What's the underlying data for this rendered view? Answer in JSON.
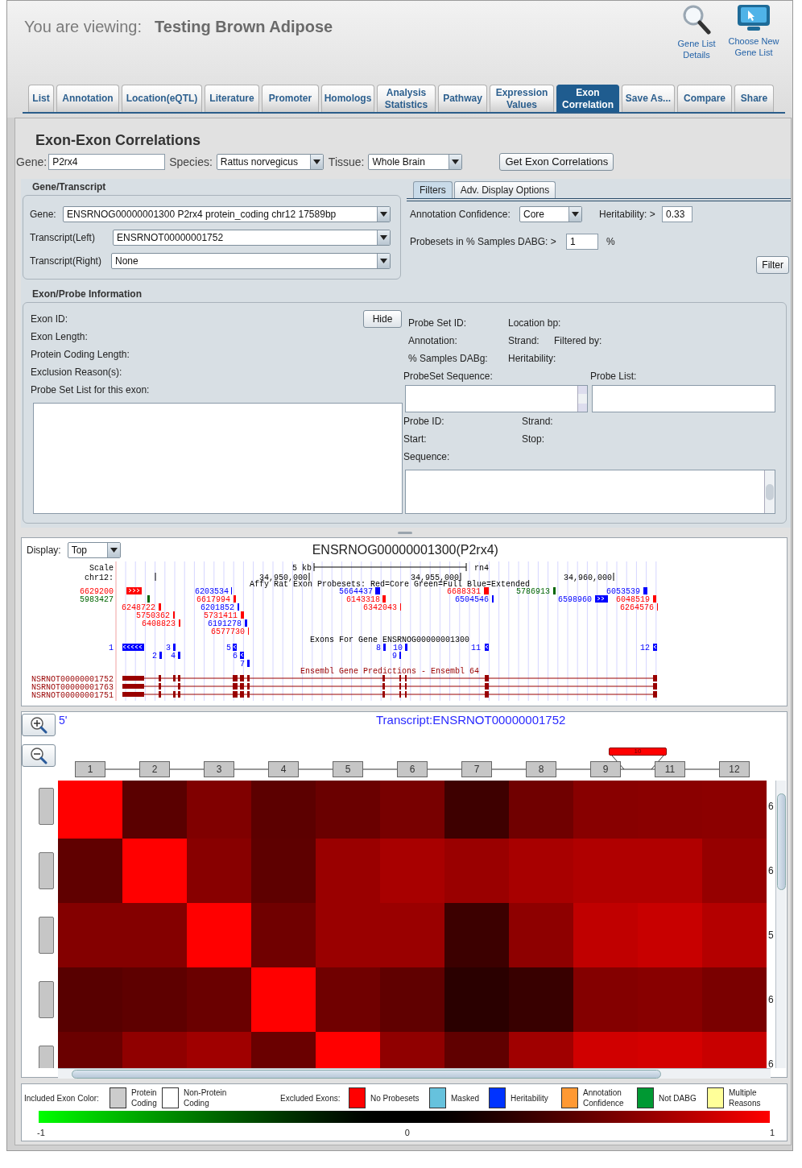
{
  "header": {
    "viewing_label": "You are viewing:",
    "list_name": "Testing Brown Adipose",
    "links": [
      {
        "label": "Gene List Details",
        "kind": "search"
      },
      {
        "label": "Choose New Gene List",
        "kind": "monitor"
      }
    ]
  },
  "tabs": [
    {
      "label": "List",
      "selected": false
    },
    {
      "label": "Annotation",
      "selected": false
    },
    {
      "label": "Location(eQTL)",
      "selected": false
    },
    {
      "label": "Literature",
      "selected": false
    },
    {
      "label": "Promoter",
      "selected": false
    },
    {
      "label": "Homologs",
      "selected": false
    },
    {
      "label": "Analysis Statistics",
      "selected": false
    },
    {
      "label": "Pathway",
      "selected": false
    },
    {
      "label": "Expression Values",
      "selected": false
    },
    {
      "label": "Exon Correlation",
      "selected": true
    },
    {
      "label": "Save As...",
      "selected": false
    },
    {
      "label": "Compare",
      "selected": false
    },
    {
      "label": "Share",
      "selected": false
    }
  ],
  "page_title": "Exon-Exon Correlations",
  "query": {
    "gene_label": "Gene:",
    "gene": "P2rx4",
    "species_label": "Species:",
    "species": "Rattus norvegicus",
    "tissue_label": "Tissue:",
    "tissue": "Whole Brain",
    "button": "Get Exon Correlations"
  },
  "gene_transcript": {
    "title": "Gene/Transcript",
    "fields": [
      {
        "label": "Gene:",
        "value": "ENSRNOG00000001300 P2rx4 protein_coding chr12 17589bp"
      },
      {
        "label": "Transcript(Left)",
        "value": "ENSRNOT00000001752"
      },
      {
        "label": "Transcript(Right)",
        "value": "None"
      }
    ]
  },
  "filter_tabs": [
    {
      "label": "Filters",
      "selected": true
    },
    {
      "label": "Adv. Display Options",
      "selected": false
    }
  ],
  "filters": {
    "annotation_label": "Annotation Confidence:",
    "annotation": "Core",
    "heritability_label": "Heritability: >",
    "heritability": "0.33",
    "dabg_label": "Probesets in % Samples DABG: >",
    "dabg": "1",
    "dabg_unit": "%",
    "button": "Filter"
  },
  "exon_info": {
    "title": "Exon/Probe Information",
    "exon_labels": [
      "Exon ID:",
      "Exon Length:",
      "Protein Coding Length:",
      "Exclusion Reason(s):",
      "Probe Set List for this exon:"
    ],
    "hide_button": "Hide",
    "probe_set_rows": [
      [
        "Probe Set ID:",
        "Location bp:"
      ],
      [
        "Annotation:",
        "Strand:",
        "Filtered by:"
      ],
      [
        "% Samples DABg:",
        "Heritability:"
      ]
    ],
    "sequence_label": "ProbeSet Sequence:",
    "probe_list_label": "Probe List:",
    "probe_rows": [
      [
        "Probe ID:",
        "Strand:"
      ],
      [
        "Start:",
        "Stop:"
      ],
      [
        "Sequence:"
      ]
    ]
  },
  "genome": {
    "display_label": "Display:",
    "display": "Top",
    "title": "ENSRNOG00000001300(P2rx4)",
    "scale_label": "Scale",
    "chrom": "chr12:",
    "scale_bar": "5 kb",
    "assembly": "rn4",
    "positions": [
      "34,950,000",
      "34,955,000",
      "34,960,000"
    ],
    "probeset_track": "Affy Rat Exon Probesets: Red=Core Green=Full Blue=Extended",
    "probesets": [
      {
        "label": "6629200",
        "color": "#ff0000"
      },
      {
        "label": "6203534",
        "color": "#0000ff"
      },
      {
        "label": "5664437",
        "color": "#0000ff"
      },
      {
        "label": "6688331",
        "color": "#ff0000"
      },
      {
        "label": "5786913",
        "color": "#006600"
      },
      {
        "label": "6053539",
        "color": "#0000ff"
      },
      {
        "label": "5983427",
        "color": "#006600"
      },
      {
        "label": "6617994",
        "color": "#ff0000"
      },
      {
        "label": "6143318",
        "color": "#ff0000"
      },
      {
        "label": "6504546",
        "color": "#0000ff"
      },
      {
        "label": "6598960",
        "color": "#0000ff"
      },
      {
        "label": "6048519",
        "color": "#ff0000"
      },
      {
        "label": "6248722",
        "color": "#ff0000"
      },
      {
        "label": "6201852",
        "color": "#0000ff"
      },
      {
        "label": "6342043",
        "color": "#ff0000"
      },
      {
        "label": "6264576",
        "color": "#ff0000"
      },
      {
        "label": "5750362",
        "color": "#ff0000"
      },
      {
        "label": "5731411",
        "color": "#ff0000"
      },
      {
        "label": "6408823",
        "color": "#ff0000"
      },
      {
        "label": "6191278",
        "color": "#0000ff"
      },
      {
        "label": "6577730",
        "color": "#ff0000"
      }
    ],
    "exon_track": "Exons For Gene ENSRNOG00000001300",
    "exons": [
      "1",
      "3",
      "5",
      "8",
      "10",
      "11",
      "12",
      "2",
      "4",
      "6",
      "9",
      "7"
    ],
    "transcript_track": "Ensembl Gene Predictions - Ensembl 64",
    "transcripts": [
      "NSRNOT00000001752",
      "NSRNOT00000001763",
      "NSRNOT00000001751"
    ]
  },
  "heatmap": {
    "end_label": "5'",
    "title": "Transcript:ENSRNOT00000001752",
    "exons": [
      {
        "label": "1",
        "excluded": false
      },
      {
        "label": "2",
        "excluded": false
      },
      {
        "label": "3",
        "excluded": false
      },
      {
        "label": "4",
        "excluded": false
      },
      {
        "label": "5",
        "excluded": false
      },
      {
        "label": "6",
        "excluded": false
      },
      {
        "label": "7",
        "excluded": false
      },
      {
        "label": "8",
        "excluded": false
      },
      {
        "label": "9",
        "excluded": false
      },
      {
        "label": "10",
        "excluded": true
      },
      {
        "label": "11",
        "excluded": false
      },
      {
        "label": "12",
        "excluded": false
      }
    ],
    "rows": [
      {
        "label": "6",
        "cells": [
          {
            "color": "#ff0000"
          },
          {
            "color": "#5a0000"
          },
          {
            "color": "#800000"
          },
          {
            "color": "#5c0000"
          },
          {
            "color": "#6a0000"
          },
          {
            "color": "#780000"
          },
          {
            "color": "#3e0000"
          },
          {
            "color": "#700000"
          },
          {
            "color": "#880000"
          },
          {
            "color": "#8a0000"
          },
          {
            "color": "#8c0000"
          }
        ]
      },
      {
        "label": "6",
        "cells": [
          {
            "color": "#600000"
          },
          {
            "color": "#ff0000"
          },
          {
            "color": "#880000"
          },
          {
            "color": "#5e0000"
          },
          {
            "color": "#9a0000"
          },
          {
            "color": "#a80000"
          },
          {
            "color": "#9a0000"
          },
          {
            "color": "#a80000"
          },
          {
            "color": "#b00000"
          },
          {
            "color": "#b00000"
          },
          {
            "color": "#960000"
          }
        ]
      },
      {
        "label": "5",
        "cells": [
          {
            "color": "#840000"
          },
          {
            "color": "#840000"
          },
          {
            "color": "#ff0000"
          },
          {
            "color": "#700000"
          },
          {
            "color": "#9a0000"
          },
          {
            "color": "#9a0000"
          },
          {
            "color": "#3c0000"
          },
          {
            "color": "#8e0000"
          },
          {
            "color": "#c00000"
          },
          {
            "color": "#c80000"
          },
          {
            "color": "#b40000"
          }
        ]
      },
      {
        "label": "6",
        "cells": [
          {
            "color": "#580000"
          },
          {
            "color": "#5e0000"
          },
          {
            "color": "#6a0000"
          },
          {
            "color": "#ff0000"
          },
          {
            "color": "#700000"
          },
          {
            "color": "#600000"
          },
          {
            "color": "#2a0000"
          },
          {
            "color": "#380000"
          },
          {
            "color": "#840000"
          },
          {
            "color": "#880000"
          },
          {
            "color": "#7a0000"
          }
        ]
      },
      {
        "label": "6",
        "cells": [
          {
            "color": "#6a0000"
          },
          {
            "color": "#900000"
          },
          {
            "color": "#a00000"
          },
          {
            "color": "#6a0000"
          },
          {
            "color": "#ff0000"
          },
          {
            "color": "#900000"
          },
          {
            "color": "#600000"
          },
          {
            "color": "#a00000"
          },
          {
            "color": "#d00000"
          },
          {
            "color": "#d40000"
          },
          {
            "color": "#c80000"
          }
        ]
      }
    ]
  },
  "legend": {
    "included_label": "Included Exon Color:",
    "included": [
      {
        "label": "Protein Coding",
        "color": "#cccccc"
      },
      {
        "label": "Non-Protein Coding",
        "color": "#ffffff"
      }
    ],
    "excluded_label": "Excluded Exons:",
    "excluded": [
      {
        "label": "No Probesets",
        "color": "#ff0000"
      },
      {
        "label": "Masked",
        "color": "#66c2dd"
      },
      {
        "label": "Heritability",
        "color": "#0033ff"
      },
      {
        "label": "Annotation Confidence",
        "color": "#ff9933"
      },
      {
        "label": "Not DABG",
        "color": "#009933"
      },
      {
        "label": "Multiple Reasons",
        "color": "#ffff99"
      }
    ],
    "scale": [
      "-1",
      "0",
      "1"
    ]
  }
}
